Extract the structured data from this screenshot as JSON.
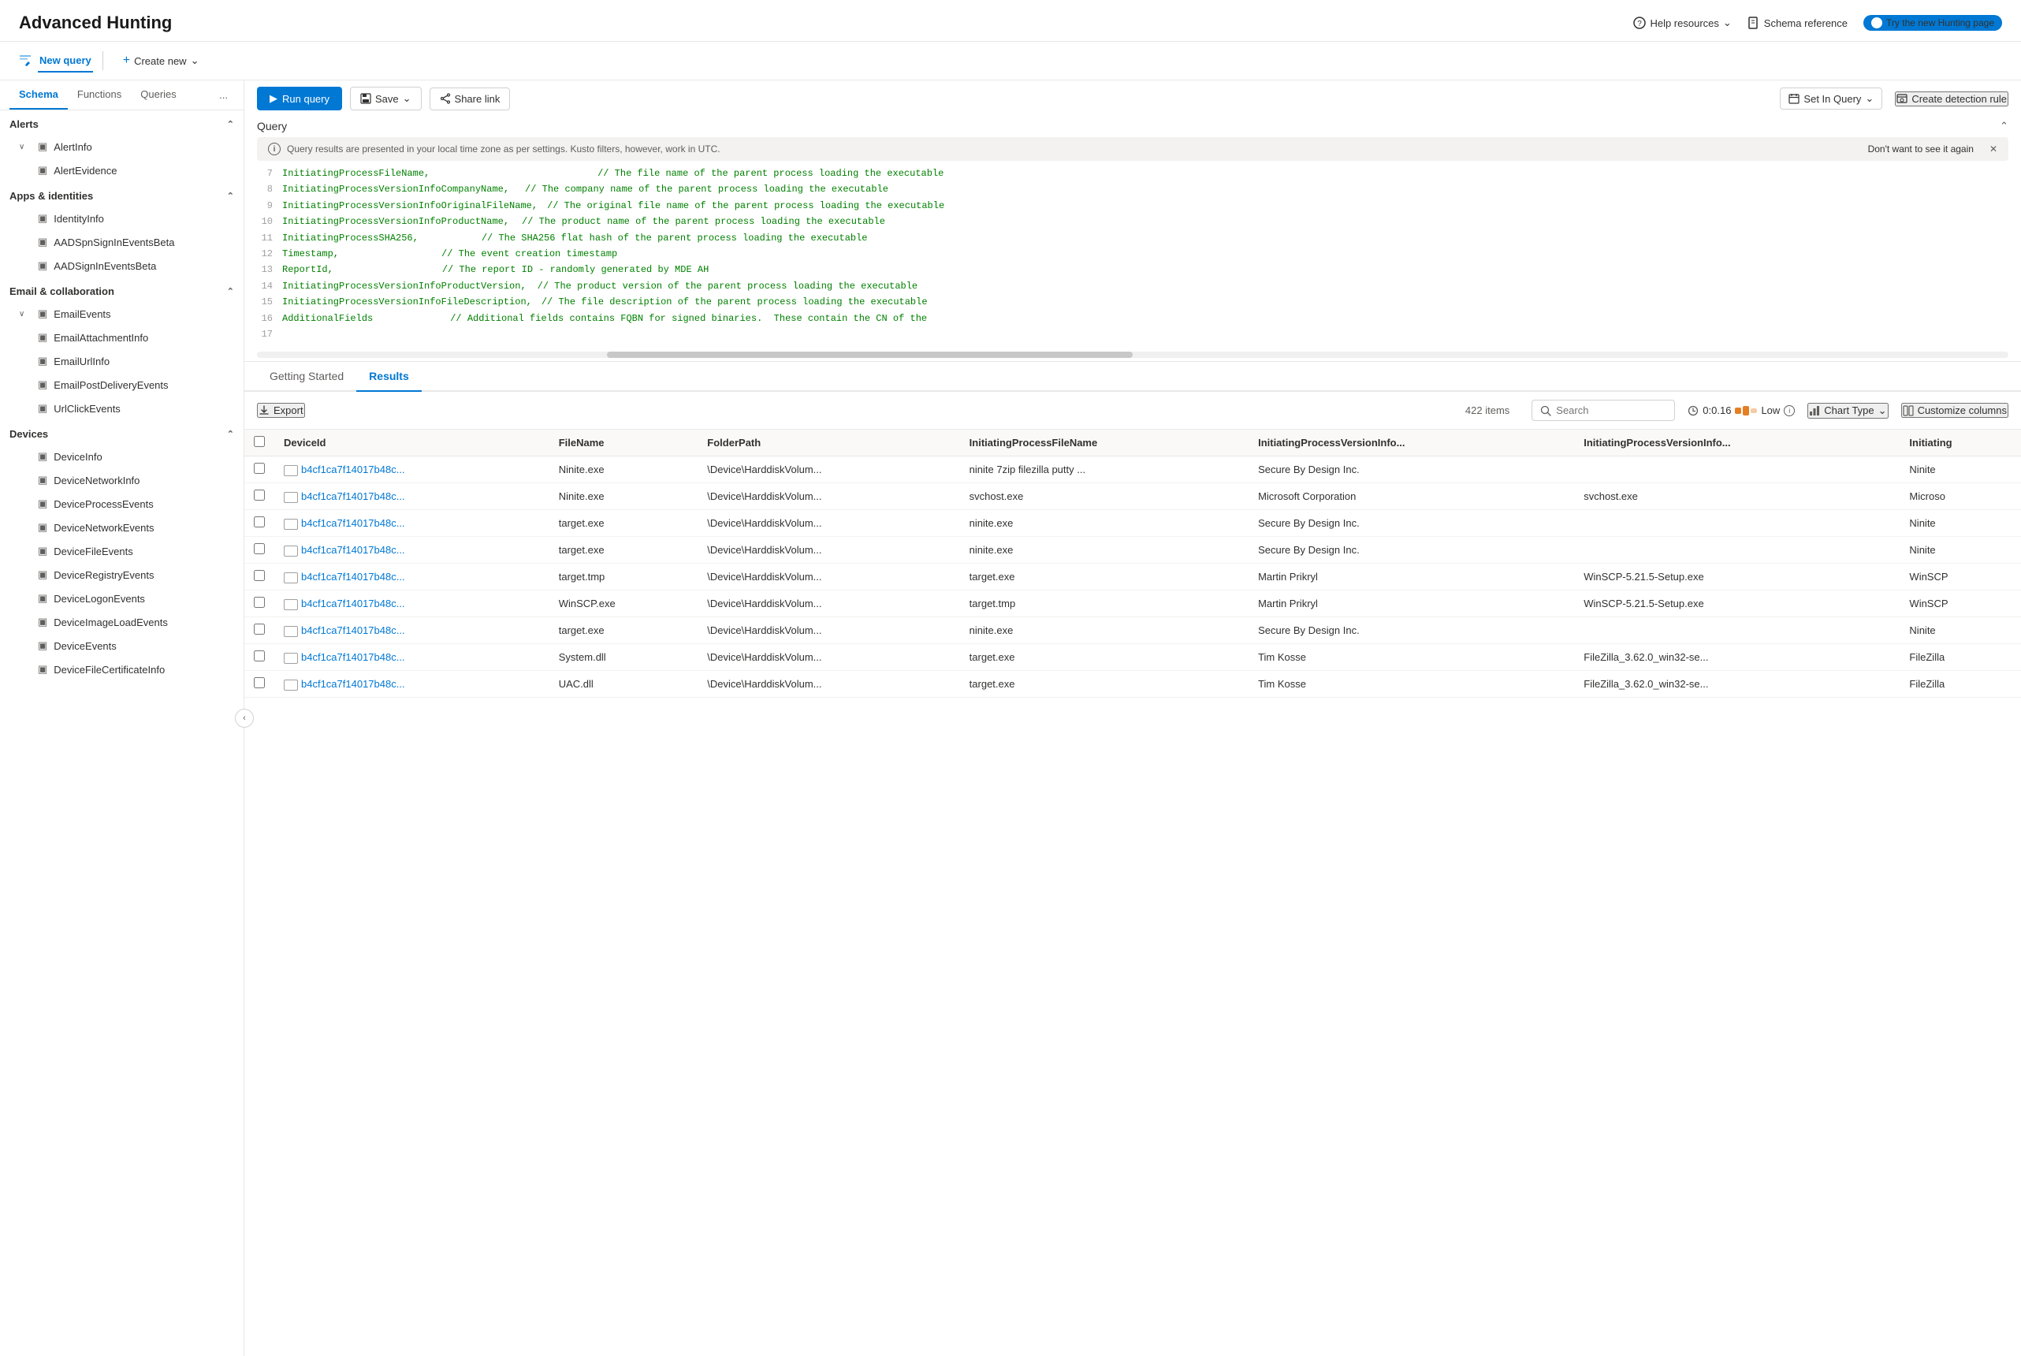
{
  "header": {
    "title": "Advanced Hunting",
    "help_resources": "Help resources",
    "schema_reference": "Schema reference",
    "try_new": "Try the new Hunting page"
  },
  "toolbar": {
    "run_query": "Run query",
    "save": "Save",
    "share_link": "Share link",
    "set_in_query": "Set In Query",
    "create_detection_rule": "Create detection rule"
  },
  "sidebar": {
    "tabs": [
      "Schema",
      "Functions",
      "Queries"
    ],
    "more_tab": "...",
    "sections": [
      {
        "name": "Alerts",
        "expanded": true,
        "items": [
          {
            "name": "AlertInfo",
            "has_children": true
          },
          {
            "name": "AlertEvidence",
            "has_children": false
          }
        ]
      },
      {
        "name": "Apps & identities",
        "expanded": true,
        "items": [
          {
            "name": "IdentityInfo",
            "has_children": false
          },
          {
            "name": "AADSpnSignInEventsBeta",
            "has_children": false
          },
          {
            "name": "AADSignInEventsBeta",
            "has_children": false
          }
        ]
      },
      {
        "name": "Email & collaboration",
        "expanded": true,
        "items": [
          {
            "name": "EmailEvents",
            "has_children": true
          },
          {
            "name": "EmailAttachmentInfo",
            "has_children": false
          },
          {
            "name": "EmailUrlInfo",
            "has_children": false
          },
          {
            "name": "EmailPostDeliveryEvents",
            "has_children": false
          },
          {
            "name": "UrlClickEvents",
            "has_children": false
          }
        ]
      },
      {
        "name": "Devices",
        "expanded": true,
        "items": [
          {
            "name": "DeviceInfo",
            "has_children": false
          },
          {
            "name": "DeviceNetworkInfo",
            "has_children": false
          },
          {
            "name": "DeviceProcessEvents",
            "has_children": false
          },
          {
            "name": "DeviceNetworkEvents",
            "has_children": false
          },
          {
            "name": "DeviceFileEvents",
            "has_children": false
          },
          {
            "name": "DeviceRegistryEvents",
            "has_children": false
          },
          {
            "name": "DeviceLogonEvents",
            "has_children": false
          },
          {
            "name": "DeviceImageLoadEvents",
            "has_children": false
          },
          {
            "name": "DeviceEvents",
            "has_children": false
          },
          {
            "name": "DeviceFileCertificateInfo",
            "has_children": false
          }
        ]
      }
    ]
  },
  "new_query_btn": "New query",
  "create_new_btn": "Create new",
  "query_section": {
    "label": "Query",
    "info_text": "Query results are presented in your local time zone as per settings. Kusto filters, however, work in UTC.",
    "dont_show": "Don't want to see it again",
    "lines": [
      {
        "num": "7",
        "content": "InitiatingProcessFileName,",
        "type": "field",
        "comment": "// The file name of the parent process loading the executable"
      },
      {
        "num": "8",
        "content": "InitiatingProcessVersionInfoCompanyName,",
        "type": "field",
        "comment": "// The company name of the parent process loading the executable"
      },
      {
        "num": "9",
        "content": "InitiatingProcessVersionInfoOriginalFileName,",
        "type": "field",
        "comment": "// The original file name of the parent process loading the executable"
      },
      {
        "num": "10",
        "content": "InitiatingProcessVersionInfoProductName,",
        "type": "field",
        "comment": "// The product name of the parent process loading the executable"
      },
      {
        "num": "11",
        "content": "InitiatingProcessSHA256,",
        "type": "field",
        "comment": "// The SHA256 flat hash of the parent process loading the executable"
      },
      {
        "num": "12",
        "content": "Timestamp,",
        "type": "field",
        "comment": "// The event creation timestamp"
      },
      {
        "num": "13",
        "content": "ReportId,",
        "type": "field",
        "comment": "// The report ID - randomly generated by MDE AH"
      },
      {
        "num": "14",
        "content": "InitiatingProcessVersionInfoProductVersion,",
        "type": "field",
        "comment": "// The product version of the parent process loading the executable"
      },
      {
        "num": "15",
        "content": "InitiatingProcessVersionInfoFileDescription,",
        "type": "field",
        "comment": "// The file description of the parent process loading the executable"
      },
      {
        "num": "16",
        "content": "AdditionalFields",
        "type": "field",
        "comment": "// Additional fields contains FQBN for signed binaries.  These contain the CN of the"
      },
      {
        "num": "17",
        "content": "",
        "type": "empty",
        "comment": ""
      }
    ]
  },
  "results": {
    "tabs": [
      "Getting Started",
      "Results"
    ],
    "active_tab": "Results",
    "export_label": "Export",
    "items_count": "422 items",
    "search_placeholder": "Search",
    "time_value": "0:0.16",
    "time_level": "Low",
    "chart_type": "Chart Type",
    "customize_columns": "Customize columns",
    "columns": [
      "DeviceId",
      "FileName",
      "FolderPath",
      "InitiatingProcessFileName",
      "InitiatingProcessVersionInfo...",
      "InitiatingProcessVersionInfo...",
      "Initiating"
    ],
    "rows": [
      {
        "deviceId": "b4cf1ca7f14017b48c...",
        "fileName": "Ninite.exe",
        "folderPath": "\\Device\\HarddiskVolum...",
        "initiatingProcessFileName": "ninite 7zip filezilla putty ...",
        "col5": "Secure By Design Inc.",
        "col6": "",
        "col7": "Ninite"
      },
      {
        "deviceId": "b4cf1ca7f14017b48c...",
        "fileName": "Ninite.exe",
        "folderPath": "\\Device\\HarddiskVolum...",
        "initiatingProcessFileName": "svchost.exe",
        "col5": "Microsoft Corporation",
        "col6": "svchost.exe",
        "col7": "Microso"
      },
      {
        "deviceId": "b4cf1ca7f14017b48c...",
        "fileName": "target.exe",
        "folderPath": "\\Device\\HarddiskVolum...",
        "initiatingProcessFileName": "ninite.exe",
        "col5": "Secure By Design Inc.",
        "col6": "",
        "col7": "Ninite"
      },
      {
        "deviceId": "b4cf1ca7f14017b48c...",
        "fileName": "target.exe",
        "folderPath": "\\Device\\HarddiskVolum...",
        "initiatingProcessFileName": "ninite.exe",
        "col5": "Secure By Design Inc.",
        "col6": "",
        "col7": "Ninite"
      },
      {
        "deviceId": "b4cf1ca7f14017b48c...",
        "fileName": "target.tmp",
        "folderPath": "\\Device\\HarddiskVolum...",
        "initiatingProcessFileName": "target.exe",
        "col5": "Martin Prikryl",
        "col6": "WinSCP-5.21.5-Setup.exe",
        "col7": "WinSCP"
      },
      {
        "deviceId": "b4cf1ca7f14017b48c...",
        "fileName": "WinSCP.exe",
        "folderPath": "\\Device\\HarddiskVolum...",
        "initiatingProcessFileName": "target.tmp",
        "col5": "Martin Prikryl",
        "col6": "WinSCP-5.21.5-Setup.exe",
        "col7": "WinSCP"
      },
      {
        "deviceId": "b4cf1ca7f14017b48c...",
        "fileName": "target.exe",
        "folderPath": "\\Device\\HarddiskVolum...",
        "initiatingProcessFileName": "ninite.exe",
        "col5": "Secure By Design Inc.",
        "col6": "",
        "col7": "Ninite"
      },
      {
        "deviceId": "b4cf1ca7f14017b48c...",
        "fileName": "System.dll",
        "folderPath": "\\Device\\HarddiskVolum...",
        "initiatingProcessFileName": "target.exe",
        "col5": "Tim Kosse",
        "col6": "FileZilla_3.62.0_win32-se...",
        "col7": "FileZilla"
      },
      {
        "deviceId": "b4cf1ca7f14017b48c...",
        "fileName": "UAC.dll",
        "folderPath": "\\Device\\HarddiskVolum...",
        "initiatingProcessFileName": "target.exe",
        "col5": "Tim Kosse",
        "col6": "FileZilla_3.62.0_win32-se...",
        "col7": "FileZilla"
      }
    ]
  }
}
